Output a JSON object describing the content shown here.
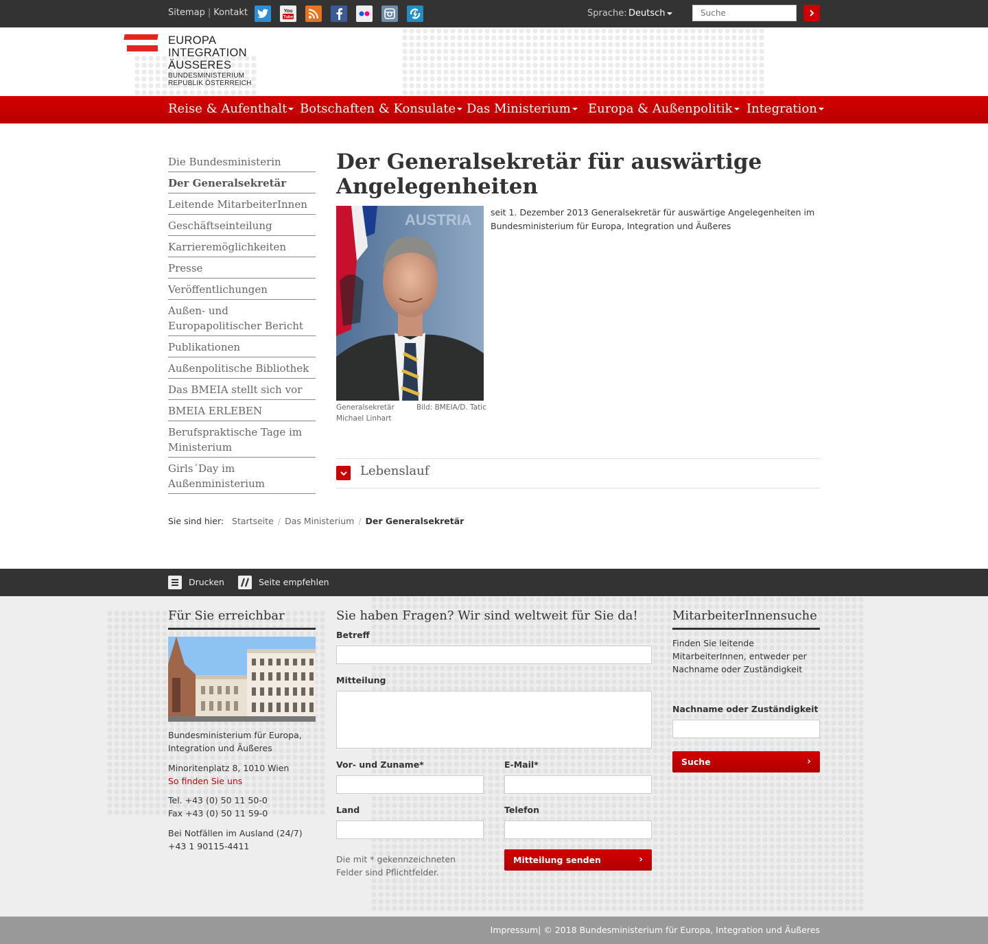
{
  "topbar": {
    "sitemap": "Sitemap",
    "separator": "|",
    "kontakt": "Kontakt",
    "language_label": "Sprache:",
    "language_value": "Deutsch",
    "search_placeholder": "Suche",
    "social": [
      "twitter-icon",
      "youtube-icon",
      "rss-icon",
      "facebook-icon",
      "flickr-icon",
      "instagram-icon",
      "slideshare-icon"
    ]
  },
  "logo": {
    "line1": "EUROPA",
    "line2": "INTEGRATION",
    "line3": "ÄUSSERES",
    "line4": "BUNDESMINISTERIUM",
    "line5": "REPUBLIK ÖSTERREICH"
  },
  "nav": {
    "items": [
      "Reise & Aufenthalt",
      "Botschaften & Konsulate",
      "Das Ministerium",
      "Europa & Außenpolitik",
      "Integration"
    ]
  },
  "sidebar": {
    "items": [
      "Die Bundesministerin",
      "Der Generalsekretär",
      "Leitende MitarbeiterInnen",
      "Geschäftseinteilung",
      "Karrieremöglichkeiten",
      "Presse",
      "Veröffentlichungen",
      "Außen- und Europapolitischer Bericht",
      "Publikationen",
      "Außenpolitische Bibliothek",
      "Das BMEIA stellt sich vor",
      "BMEIA ERLEBEN",
      "Berufspraktische Tage im Ministerium",
      "Girls´Day im Außenministerium"
    ]
  },
  "main": {
    "title": "Der Generalsekretär für auswärtige Angelegenheiten",
    "intro": "seit 1. Dezember 2013 Generalsekretär für auswärtige Angelegenheiten im Bundesministerium für Europa, Integration und Äußeres",
    "photo_caption": "Generalsekretär Michael Linhart",
    "photo_credit": "Bild: BMEIA/D. Tatic",
    "photo_banner_text": "AUSTRIA",
    "accordion_label": "Lebenslauf"
  },
  "breadcrumb": {
    "label": "Sie sind hier:",
    "items": [
      "Startseite",
      "Das Ministerium"
    ],
    "current": "Der Generalsekretär"
  },
  "tools": {
    "print": "Drucken",
    "recommend": "Seite empfehlen"
  },
  "footer": {
    "contact": {
      "heading": "Für Sie erreichbar",
      "org": "Bundesministerium für Europa, Integration und Äußeres",
      "address": "Minoritenplatz 8, 1010 Wien",
      "directions": "So finden Sie uns",
      "tel": "Tel. +43 (0) 50 11 50-0",
      "fax": "Fax +43 (0) 50 11 59-0",
      "emergency_label": "Bei Notfällen im Ausland (24/7)",
      "emergency_tel": "+43 1 90115-4411"
    },
    "form": {
      "heading": "Sie haben Fragen? Wir sind weltweit für Sie da!",
      "subject_label": "Betreff",
      "message_label": "Mitteilung",
      "name_label": "Vor- und Zuname*",
      "email_label": "E-Mail*",
      "country_label": "Land",
      "phone_label": "Telefon",
      "required_note": "Die mit * gekennzeichneten Felder sind Pflichtfelder.",
      "submit": "Mitteilung senden"
    },
    "staff_search": {
      "heading": "MitarbeiterInnensuche",
      "desc": "Finden Sie leitende MitarbeiterInnen, entweder per Nachname oder Zuständigkeit",
      "field_label": "Nachname oder Zuständigkeit",
      "button": "Suche"
    }
  },
  "bottom": {
    "impressum": "Impressum",
    "copyright": "| © 2018 Bundesministerium für Europa, Integration und Äußeres"
  },
  "colors": {
    "accent": "#cc0000",
    "topbar": "#333333",
    "footer_bg": "#eeeeee",
    "bottom_bar": "#999999"
  }
}
